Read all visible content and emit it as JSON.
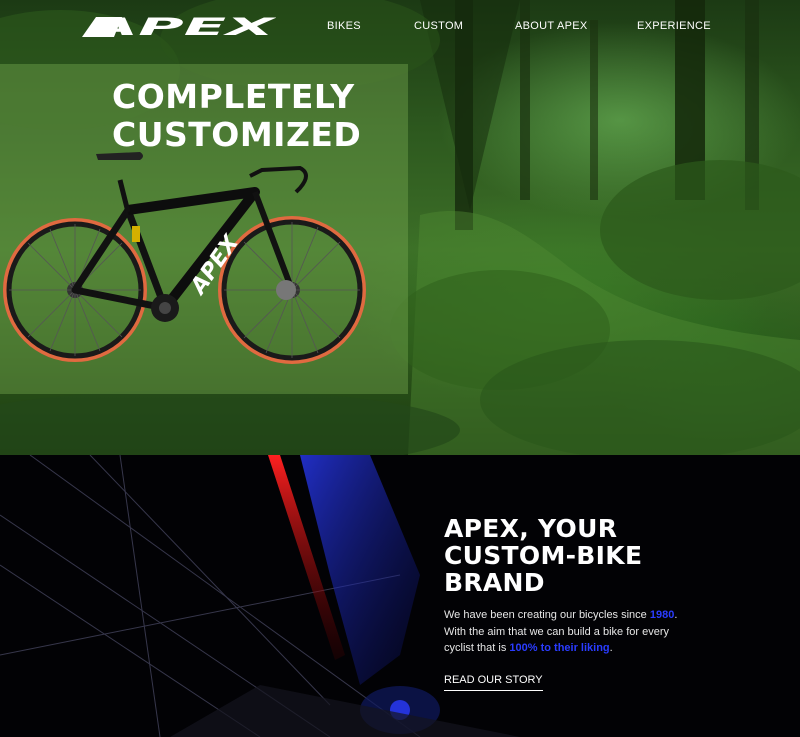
{
  "brand": {
    "logo_text": "APEX"
  },
  "nav": {
    "items": [
      {
        "label": "BIKES"
      },
      {
        "label": "CUSTOM"
      },
      {
        "label": "ABOUT APEX"
      },
      {
        "label": "EXPERIENCE"
      }
    ]
  },
  "hero": {
    "title_line1": "COMPLETELY",
    "title_line2": "CUSTOMIZED",
    "bike_downtube_text": "APEX"
  },
  "story": {
    "heading_line1": "APEX, YOUR",
    "heading_line2": "CUSTOM-BIKE",
    "heading_line3": "BRAND",
    "text_part1": "We have been creating our bicycles since ",
    "year": "1980",
    "text_part2": ". With the aim that we can build a bike for every cyclist that is ",
    "liking": "100% to their liking",
    "text_part3": ".",
    "link_label": "READ OUR STORY"
  },
  "colors": {
    "accent": "#2a3cff",
    "forest": "#3c6e27",
    "panel": "#78aa50",
    "tire": "#e06a40"
  }
}
